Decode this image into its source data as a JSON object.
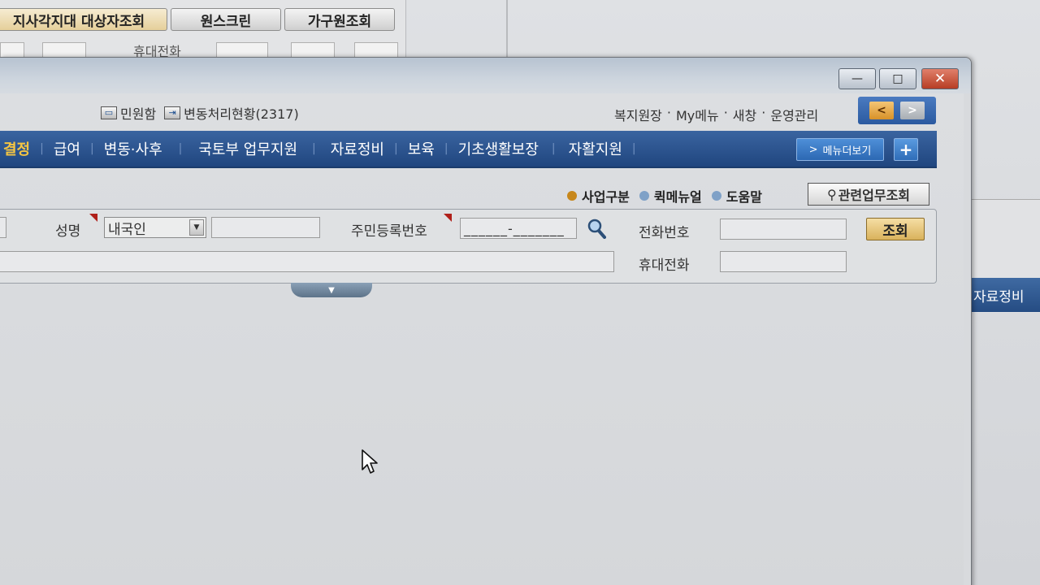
{
  "background_window": {
    "buttons": [
      "지사각지대 대상자조회",
      "원스크린",
      "가구원조회"
    ],
    "partial_label": "휴대전화",
    "right_nav_label": "자료정비"
  },
  "window_controls": {
    "minimize": "—",
    "maximize": "□",
    "close": "✕"
  },
  "top_links": {
    "inbox": "민원함",
    "changes": "변동처리현황(2317)"
  },
  "user_links": [
    "복지원장",
    "·",
    "My메뉴",
    "·",
    "새창",
    "·",
    "운영관리"
  ],
  "nav_arrows": {
    "prev": "<",
    "next": ">"
  },
  "menu": {
    "items": [
      "결정",
      "급여",
      "변동·사후",
      "국토부 업무지원",
      "자료정비",
      "보육",
      "기초생활보장",
      "자활지원"
    ],
    "more_label": "메뉴더보기",
    "more_prefix": ">",
    "plus_label": "+"
  },
  "help_links": {
    "business": "사업구분",
    "quick_manual": "퀵메뉴얼",
    "help": "도움말",
    "related_button": "관련업무조회"
  },
  "search_form": {
    "name_label": "성명",
    "nationality_select": "내국인",
    "name_value": "",
    "resident_id_label": "주민등록번호",
    "resident_id_mask": "______-_______",
    "phone_label": "전화번호",
    "phone_value": "",
    "mobile_label": "휴대전화",
    "mobile_value": "",
    "address_value": "",
    "query_button": "조회",
    "collapse_label": "▼"
  },
  "colors": {
    "menu_bg": "#2c5590",
    "menu_active": "#f5c542",
    "query_button": "#e1c070",
    "required_marker": "#b0201a"
  }
}
